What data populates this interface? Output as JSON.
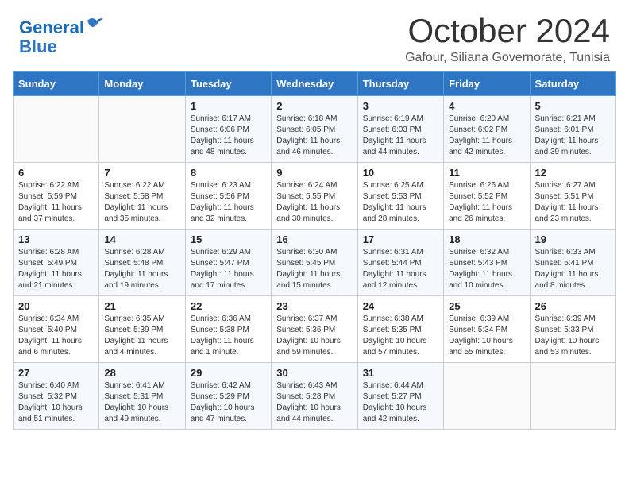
{
  "header": {
    "logo_line1": "General",
    "logo_line2": "Blue",
    "month": "October 2024",
    "location": "Gafour, Siliana Governorate, Tunisia"
  },
  "days_of_week": [
    "Sunday",
    "Monday",
    "Tuesday",
    "Wednesday",
    "Thursday",
    "Friday",
    "Saturday"
  ],
  "weeks": [
    [
      {
        "day": "",
        "sunrise": "",
        "sunset": "",
        "daylight": ""
      },
      {
        "day": "",
        "sunrise": "",
        "sunset": "",
        "daylight": ""
      },
      {
        "day": "1",
        "sunrise": "Sunrise: 6:17 AM",
        "sunset": "Sunset: 6:06 PM",
        "daylight": "Daylight: 11 hours and 48 minutes."
      },
      {
        "day": "2",
        "sunrise": "Sunrise: 6:18 AM",
        "sunset": "Sunset: 6:05 PM",
        "daylight": "Daylight: 11 hours and 46 minutes."
      },
      {
        "day": "3",
        "sunrise": "Sunrise: 6:19 AM",
        "sunset": "Sunset: 6:03 PM",
        "daylight": "Daylight: 11 hours and 44 minutes."
      },
      {
        "day": "4",
        "sunrise": "Sunrise: 6:20 AM",
        "sunset": "Sunset: 6:02 PM",
        "daylight": "Daylight: 11 hours and 42 minutes."
      },
      {
        "day": "5",
        "sunrise": "Sunrise: 6:21 AM",
        "sunset": "Sunset: 6:01 PM",
        "daylight": "Daylight: 11 hours and 39 minutes."
      }
    ],
    [
      {
        "day": "6",
        "sunrise": "Sunrise: 6:22 AM",
        "sunset": "Sunset: 5:59 PM",
        "daylight": "Daylight: 11 hours and 37 minutes."
      },
      {
        "day": "7",
        "sunrise": "Sunrise: 6:22 AM",
        "sunset": "Sunset: 5:58 PM",
        "daylight": "Daylight: 11 hours and 35 minutes."
      },
      {
        "day": "8",
        "sunrise": "Sunrise: 6:23 AM",
        "sunset": "Sunset: 5:56 PM",
        "daylight": "Daylight: 11 hours and 32 minutes."
      },
      {
        "day": "9",
        "sunrise": "Sunrise: 6:24 AM",
        "sunset": "Sunset: 5:55 PM",
        "daylight": "Daylight: 11 hours and 30 minutes."
      },
      {
        "day": "10",
        "sunrise": "Sunrise: 6:25 AM",
        "sunset": "Sunset: 5:53 PM",
        "daylight": "Daylight: 11 hours and 28 minutes."
      },
      {
        "day": "11",
        "sunrise": "Sunrise: 6:26 AM",
        "sunset": "Sunset: 5:52 PM",
        "daylight": "Daylight: 11 hours and 26 minutes."
      },
      {
        "day": "12",
        "sunrise": "Sunrise: 6:27 AM",
        "sunset": "Sunset: 5:51 PM",
        "daylight": "Daylight: 11 hours and 23 minutes."
      }
    ],
    [
      {
        "day": "13",
        "sunrise": "Sunrise: 6:28 AM",
        "sunset": "Sunset: 5:49 PM",
        "daylight": "Daylight: 11 hours and 21 minutes."
      },
      {
        "day": "14",
        "sunrise": "Sunrise: 6:28 AM",
        "sunset": "Sunset: 5:48 PM",
        "daylight": "Daylight: 11 hours and 19 minutes."
      },
      {
        "day": "15",
        "sunrise": "Sunrise: 6:29 AM",
        "sunset": "Sunset: 5:47 PM",
        "daylight": "Daylight: 11 hours and 17 minutes."
      },
      {
        "day": "16",
        "sunrise": "Sunrise: 6:30 AM",
        "sunset": "Sunset: 5:45 PM",
        "daylight": "Daylight: 11 hours and 15 minutes."
      },
      {
        "day": "17",
        "sunrise": "Sunrise: 6:31 AM",
        "sunset": "Sunset: 5:44 PM",
        "daylight": "Daylight: 11 hours and 12 minutes."
      },
      {
        "day": "18",
        "sunrise": "Sunrise: 6:32 AM",
        "sunset": "Sunset: 5:43 PM",
        "daylight": "Daylight: 11 hours and 10 minutes."
      },
      {
        "day": "19",
        "sunrise": "Sunrise: 6:33 AM",
        "sunset": "Sunset: 5:41 PM",
        "daylight": "Daylight: 11 hours and 8 minutes."
      }
    ],
    [
      {
        "day": "20",
        "sunrise": "Sunrise: 6:34 AM",
        "sunset": "Sunset: 5:40 PM",
        "daylight": "Daylight: 11 hours and 6 minutes."
      },
      {
        "day": "21",
        "sunrise": "Sunrise: 6:35 AM",
        "sunset": "Sunset: 5:39 PM",
        "daylight": "Daylight: 11 hours and 4 minutes."
      },
      {
        "day": "22",
        "sunrise": "Sunrise: 6:36 AM",
        "sunset": "Sunset: 5:38 PM",
        "daylight": "Daylight: 11 hours and 1 minute."
      },
      {
        "day": "23",
        "sunrise": "Sunrise: 6:37 AM",
        "sunset": "Sunset: 5:36 PM",
        "daylight": "Daylight: 10 hours and 59 minutes."
      },
      {
        "day": "24",
        "sunrise": "Sunrise: 6:38 AM",
        "sunset": "Sunset: 5:35 PM",
        "daylight": "Daylight: 10 hours and 57 minutes."
      },
      {
        "day": "25",
        "sunrise": "Sunrise: 6:39 AM",
        "sunset": "Sunset: 5:34 PM",
        "daylight": "Daylight: 10 hours and 55 minutes."
      },
      {
        "day": "26",
        "sunrise": "Sunrise: 6:39 AM",
        "sunset": "Sunset: 5:33 PM",
        "daylight": "Daylight: 10 hours and 53 minutes."
      }
    ],
    [
      {
        "day": "27",
        "sunrise": "Sunrise: 6:40 AM",
        "sunset": "Sunset: 5:32 PM",
        "daylight": "Daylight: 10 hours and 51 minutes."
      },
      {
        "day": "28",
        "sunrise": "Sunrise: 6:41 AM",
        "sunset": "Sunset: 5:31 PM",
        "daylight": "Daylight: 10 hours and 49 minutes."
      },
      {
        "day": "29",
        "sunrise": "Sunrise: 6:42 AM",
        "sunset": "Sunset: 5:29 PM",
        "daylight": "Daylight: 10 hours and 47 minutes."
      },
      {
        "day": "30",
        "sunrise": "Sunrise: 6:43 AM",
        "sunset": "Sunset: 5:28 PM",
        "daylight": "Daylight: 10 hours and 44 minutes."
      },
      {
        "day": "31",
        "sunrise": "Sunrise: 6:44 AM",
        "sunset": "Sunset: 5:27 PM",
        "daylight": "Daylight: 10 hours and 42 minutes."
      },
      {
        "day": "",
        "sunrise": "",
        "sunset": "",
        "daylight": ""
      },
      {
        "day": "",
        "sunrise": "",
        "sunset": "",
        "daylight": ""
      }
    ]
  ]
}
